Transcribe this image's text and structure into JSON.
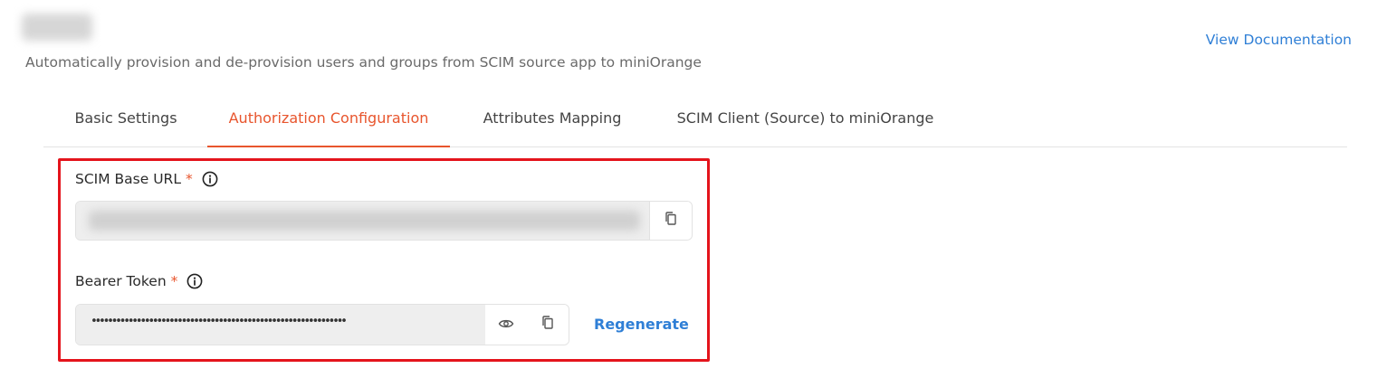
{
  "header": {
    "subtitle": "Automatically provision and de-provision users and groups from SCIM source app to miniOrange",
    "view_documentation": "View Documentation"
  },
  "tabs": [
    {
      "label": "Basic Settings",
      "active": false
    },
    {
      "label": "Authorization Configuration",
      "active": true
    },
    {
      "label": "Attributes Mapping",
      "active": false
    },
    {
      "label": "SCIM Client (Source) to miniOrange",
      "active": false
    }
  ],
  "form": {
    "scim_base_url": {
      "label": "SCIM Base URL",
      "required_mark": "*",
      "value_visible": false,
      "icons": [
        "info-icon",
        "copy-icon"
      ]
    },
    "bearer_token": {
      "label": "Bearer Token",
      "required_mark": "*",
      "value": "••••••••••••••••••••••••••••••••••••••••••••••••••••••••••••••",
      "icons": [
        "info-icon",
        "eye-icon",
        "copy-icon"
      ],
      "regenerate_label": "Regenerate"
    }
  },
  "colors": {
    "accent": "#e8552d",
    "link": "#2f7fd6",
    "highlight_border": "#e4141c"
  }
}
